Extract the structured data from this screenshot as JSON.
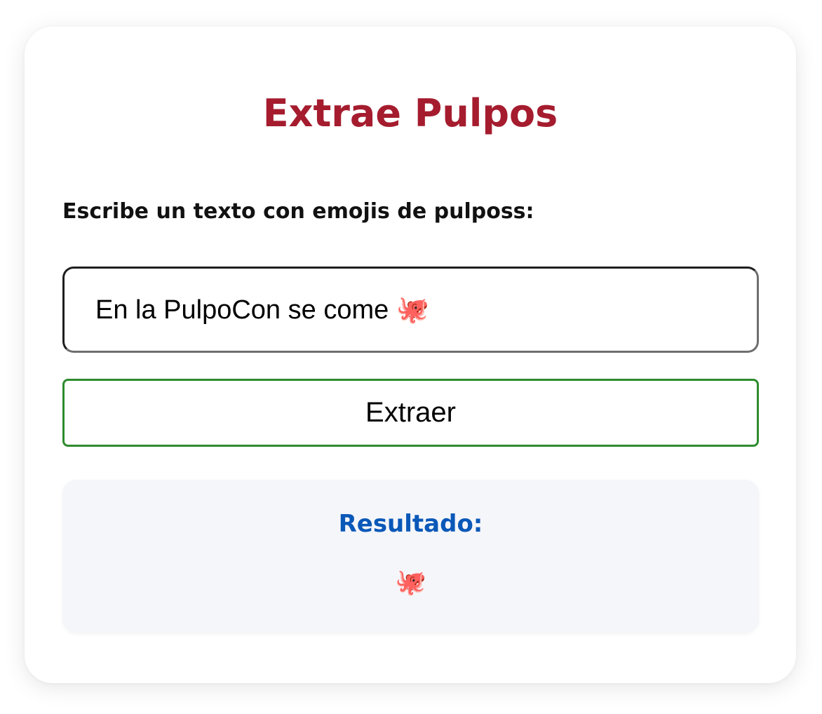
{
  "app": {
    "title": "Extrae Pulpos"
  },
  "form": {
    "label": "Escribe un texto con emojis de pulposs:",
    "input_value": "En la PulpoCon se come 🐙",
    "button_label": "Extraer"
  },
  "result": {
    "heading": "Resultado:",
    "value": "🐙"
  },
  "colors": {
    "title": "#a51c2e",
    "button_border": "#2e8b2e",
    "result_heading": "#0a58b8",
    "result_background": "#f5f6fa"
  }
}
